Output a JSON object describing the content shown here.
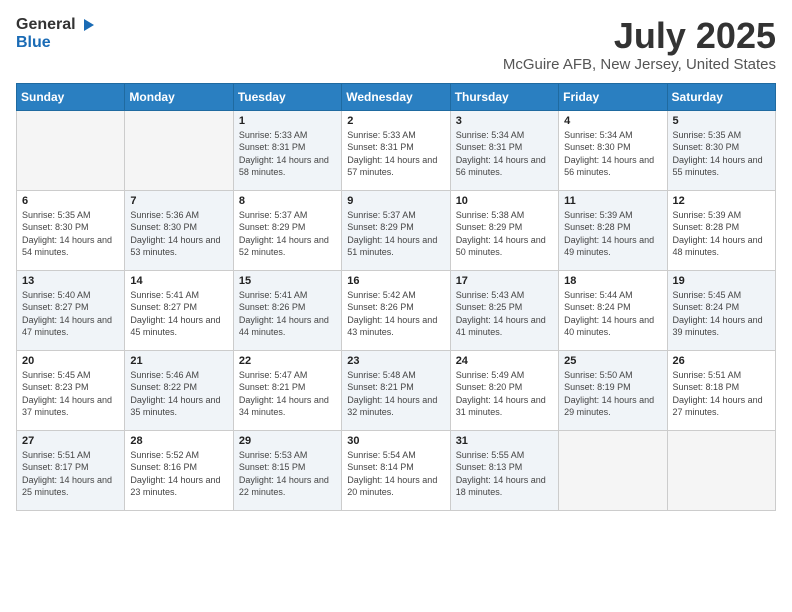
{
  "logo": {
    "general": "General",
    "blue": "Blue"
  },
  "title": "July 2025",
  "subtitle": "McGuire AFB, New Jersey, United States",
  "days": [
    "Sunday",
    "Monday",
    "Tuesday",
    "Wednesday",
    "Thursday",
    "Friday",
    "Saturday"
  ],
  "weeks": [
    [
      {
        "day": "",
        "sunrise": "",
        "sunset": "",
        "daylight": "",
        "empty": true
      },
      {
        "day": "",
        "sunrise": "",
        "sunset": "",
        "daylight": "",
        "empty": true
      },
      {
        "day": "1",
        "sunrise": "Sunrise: 5:33 AM",
        "sunset": "Sunset: 8:31 PM",
        "daylight": "Daylight: 14 hours and 58 minutes.",
        "shaded": true
      },
      {
        "day": "2",
        "sunrise": "Sunrise: 5:33 AM",
        "sunset": "Sunset: 8:31 PM",
        "daylight": "Daylight: 14 hours and 57 minutes."
      },
      {
        "day": "3",
        "sunrise": "Sunrise: 5:34 AM",
        "sunset": "Sunset: 8:31 PM",
        "daylight": "Daylight: 14 hours and 56 minutes.",
        "shaded": true
      },
      {
        "day": "4",
        "sunrise": "Sunrise: 5:34 AM",
        "sunset": "Sunset: 8:30 PM",
        "daylight": "Daylight: 14 hours and 56 minutes."
      },
      {
        "day": "5",
        "sunrise": "Sunrise: 5:35 AM",
        "sunset": "Sunset: 8:30 PM",
        "daylight": "Daylight: 14 hours and 55 minutes.",
        "shaded": true
      }
    ],
    [
      {
        "day": "6",
        "sunrise": "Sunrise: 5:35 AM",
        "sunset": "Sunset: 8:30 PM",
        "daylight": "Daylight: 14 hours and 54 minutes."
      },
      {
        "day": "7",
        "sunrise": "Sunrise: 5:36 AM",
        "sunset": "Sunset: 8:30 PM",
        "daylight": "Daylight: 14 hours and 53 minutes.",
        "shaded": true
      },
      {
        "day": "8",
        "sunrise": "Sunrise: 5:37 AM",
        "sunset": "Sunset: 8:29 PM",
        "daylight": "Daylight: 14 hours and 52 minutes."
      },
      {
        "day": "9",
        "sunrise": "Sunrise: 5:37 AM",
        "sunset": "Sunset: 8:29 PM",
        "daylight": "Daylight: 14 hours and 51 minutes.",
        "shaded": true
      },
      {
        "day": "10",
        "sunrise": "Sunrise: 5:38 AM",
        "sunset": "Sunset: 8:29 PM",
        "daylight": "Daylight: 14 hours and 50 minutes."
      },
      {
        "day": "11",
        "sunrise": "Sunrise: 5:39 AM",
        "sunset": "Sunset: 8:28 PM",
        "daylight": "Daylight: 14 hours and 49 minutes.",
        "shaded": true
      },
      {
        "day": "12",
        "sunrise": "Sunrise: 5:39 AM",
        "sunset": "Sunset: 8:28 PM",
        "daylight": "Daylight: 14 hours and 48 minutes."
      }
    ],
    [
      {
        "day": "13",
        "sunrise": "Sunrise: 5:40 AM",
        "sunset": "Sunset: 8:27 PM",
        "daylight": "Daylight: 14 hours and 47 minutes.",
        "shaded": true
      },
      {
        "day": "14",
        "sunrise": "Sunrise: 5:41 AM",
        "sunset": "Sunset: 8:27 PM",
        "daylight": "Daylight: 14 hours and 45 minutes."
      },
      {
        "day": "15",
        "sunrise": "Sunrise: 5:41 AM",
        "sunset": "Sunset: 8:26 PM",
        "daylight": "Daylight: 14 hours and 44 minutes.",
        "shaded": true
      },
      {
        "day": "16",
        "sunrise": "Sunrise: 5:42 AM",
        "sunset": "Sunset: 8:26 PM",
        "daylight": "Daylight: 14 hours and 43 minutes."
      },
      {
        "day": "17",
        "sunrise": "Sunrise: 5:43 AM",
        "sunset": "Sunset: 8:25 PM",
        "daylight": "Daylight: 14 hours and 41 minutes.",
        "shaded": true
      },
      {
        "day": "18",
        "sunrise": "Sunrise: 5:44 AM",
        "sunset": "Sunset: 8:24 PM",
        "daylight": "Daylight: 14 hours and 40 minutes."
      },
      {
        "day": "19",
        "sunrise": "Sunrise: 5:45 AM",
        "sunset": "Sunset: 8:24 PM",
        "daylight": "Daylight: 14 hours and 39 minutes.",
        "shaded": true
      }
    ],
    [
      {
        "day": "20",
        "sunrise": "Sunrise: 5:45 AM",
        "sunset": "Sunset: 8:23 PM",
        "daylight": "Daylight: 14 hours and 37 minutes."
      },
      {
        "day": "21",
        "sunrise": "Sunrise: 5:46 AM",
        "sunset": "Sunset: 8:22 PM",
        "daylight": "Daylight: 14 hours and 35 minutes.",
        "shaded": true
      },
      {
        "day": "22",
        "sunrise": "Sunrise: 5:47 AM",
        "sunset": "Sunset: 8:21 PM",
        "daylight": "Daylight: 14 hours and 34 minutes."
      },
      {
        "day": "23",
        "sunrise": "Sunrise: 5:48 AM",
        "sunset": "Sunset: 8:21 PM",
        "daylight": "Daylight: 14 hours and 32 minutes.",
        "shaded": true
      },
      {
        "day": "24",
        "sunrise": "Sunrise: 5:49 AM",
        "sunset": "Sunset: 8:20 PM",
        "daylight": "Daylight: 14 hours and 31 minutes."
      },
      {
        "day": "25",
        "sunrise": "Sunrise: 5:50 AM",
        "sunset": "Sunset: 8:19 PM",
        "daylight": "Daylight: 14 hours and 29 minutes.",
        "shaded": true
      },
      {
        "day": "26",
        "sunrise": "Sunrise: 5:51 AM",
        "sunset": "Sunset: 8:18 PM",
        "daylight": "Daylight: 14 hours and 27 minutes."
      }
    ],
    [
      {
        "day": "27",
        "sunrise": "Sunrise: 5:51 AM",
        "sunset": "Sunset: 8:17 PM",
        "daylight": "Daylight: 14 hours and 25 minutes.",
        "shaded": true
      },
      {
        "day": "28",
        "sunrise": "Sunrise: 5:52 AM",
        "sunset": "Sunset: 8:16 PM",
        "daylight": "Daylight: 14 hours and 23 minutes."
      },
      {
        "day": "29",
        "sunrise": "Sunrise: 5:53 AM",
        "sunset": "Sunset: 8:15 PM",
        "daylight": "Daylight: 14 hours and 22 minutes.",
        "shaded": true
      },
      {
        "day": "30",
        "sunrise": "Sunrise: 5:54 AM",
        "sunset": "Sunset: 8:14 PM",
        "daylight": "Daylight: 14 hours and 20 minutes."
      },
      {
        "day": "31",
        "sunrise": "Sunrise: 5:55 AM",
        "sunset": "Sunset: 8:13 PM",
        "daylight": "Daylight: 14 hours and 18 minutes.",
        "shaded": true
      },
      {
        "day": "",
        "sunrise": "",
        "sunset": "",
        "daylight": "",
        "empty": true
      },
      {
        "day": "",
        "sunrise": "",
        "sunset": "",
        "daylight": "",
        "empty": true
      }
    ]
  ]
}
